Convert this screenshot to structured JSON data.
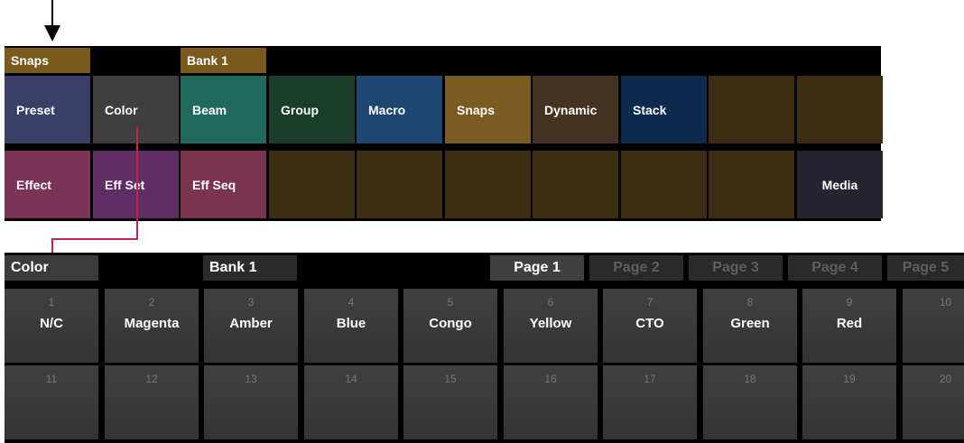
{
  "top_panel": {
    "tabs": {
      "left": "Snaps",
      "bank": "Bank 1"
    },
    "tab_colors": {
      "snaps": "#7a5a1e",
      "bank": "#7a5a1e"
    },
    "row1": [
      {
        "label": "Preset",
        "color": "#3a3f66"
      },
      {
        "label": "Color",
        "color": "#3f3f3f"
      },
      {
        "label": "Beam",
        "color": "#1f6a5c"
      },
      {
        "label": "Group",
        "color": "#1b3d2c"
      },
      {
        "label": "Macro",
        "color": "#1d4670"
      },
      {
        "label": "Snaps",
        "color": "#7a5c22"
      },
      {
        "label": "Dynamic",
        "color": "#443322"
      },
      {
        "label": "Stack",
        "color": "#0e2a4c"
      },
      {
        "label": "",
        "color": "#3d2d12"
      },
      {
        "label": "",
        "color": "#3d2d12"
      }
    ],
    "row2": [
      {
        "label": "Effect",
        "color": "#7a3458"
      },
      {
        "label": "Eff Set",
        "color": "#5e2d63"
      },
      {
        "label": "Eff Seq",
        "color": "#7a3450"
      },
      {
        "label": "",
        "color": "#3d2d12"
      },
      {
        "label": "",
        "color": "#3d2d12"
      },
      {
        "label": "",
        "color": "#3d2d12"
      },
      {
        "label": "",
        "color": "#3d2d12"
      },
      {
        "label": "",
        "color": "#3d2d12"
      },
      {
        "label": "",
        "color": "#3d2d12"
      },
      {
        "label": "Media",
        "color": "#26242e"
      }
    ]
  },
  "bottom_panel": {
    "tabs": {
      "left": "Color",
      "bank": "Bank 1",
      "pages": [
        {
          "label": "Page 1",
          "active": true
        },
        {
          "label": "Page 2",
          "active": false
        },
        {
          "label": "Page 3",
          "active": false
        },
        {
          "label": "Page 4",
          "active": false
        },
        {
          "label": "Page 5",
          "active": false
        }
      ]
    },
    "row1": [
      {
        "num": "1",
        "label": "N/C"
      },
      {
        "num": "2",
        "label": "Magenta"
      },
      {
        "num": "3",
        "label": "Amber"
      },
      {
        "num": "4",
        "label": "Blue"
      },
      {
        "num": "5",
        "label": "Congo"
      },
      {
        "num": "6",
        "label": "Yellow"
      },
      {
        "num": "7",
        "label": "CTO"
      },
      {
        "num": "8",
        "label": "Green"
      },
      {
        "num": "9",
        "label": "Red"
      },
      {
        "num": "10",
        "label": ""
      }
    ],
    "row2": [
      {
        "num": "11",
        "label": ""
      },
      {
        "num": "12",
        "label": ""
      },
      {
        "num": "13",
        "label": ""
      },
      {
        "num": "14",
        "label": ""
      },
      {
        "num": "15",
        "label": ""
      },
      {
        "num": "16",
        "label": ""
      },
      {
        "num": "17",
        "label": ""
      },
      {
        "num": "18",
        "label": ""
      },
      {
        "num": "19",
        "label": ""
      },
      {
        "num": "20",
        "label": ""
      }
    ]
  },
  "colors": {
    "connector": "#c8204c",
    "active_tab": "#404040",
    "inactive_tab": "#2a2a2a"
  }
}
